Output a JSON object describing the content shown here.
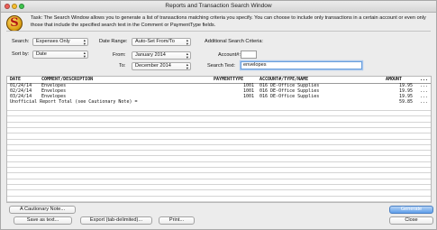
{
  "window": {
    "title": "Reports and Transaction Search Window"
  },
  "logo": {
    "glyph": "S"
  },
  "task_text": "Task: The Search Window allows you to generate a list of transactions matching criteria you specify. You can choose to include only transactions in a certain account or even only those that include the specified search text in the Comment or PaymentType fields.",
  "form": {
    "search_label": "Search:",
    "search_value": "Expenses Only",
    "sortby_label": "Sort by:",
    "sortby_value": "Date",
    "daterange_label": "Date Range:",
    "daterange_value": "Auto-Set From/To",
    "from_label": "From:",
    "from_value": "January 2014",
    "to_label": "To:",
    "to_value": "December 2014",
    "additional_label": "Additional Search Criteria:",
    "account_label": "Account#:",
    "account_value": "",
    "searchtext_label": "Search Text:",
    "searchtext_value": "envelopes"
  },
  "table": {
    "columns": [
      "DATE",
      "COMMENT/DESCRIPTION",
      "PAYMENTTYPE",
      "ACCOUNT#/TYPE/NAME",
      "AMOUNT",
      "..."
    ],
    "rows": [
      [
        "01/24/14",
        "Envelopes",
        "1001",
        "016  DE-Office Supplies",
        "19.95",
        "..."
      ],
      [
        "02/24/14",
        "Envelopes",
        "1001",
        "016  DE-Office Supplies",
        "19.95",
        "..."
      ],
      [
        "03/24/14",
        "Envelopes",
        "1001",
        "016  DE-Office Supplies",
        "19.95",
        "..."
      ]
    ],
    "total_label": "Unofficial Report Total (see Cautionary Note) =",
    "total_value": "59.85",
    "total_dots": "..."
  },
  "buttons": {
    "cautionary": "A Cautionary Note...",
    "generate": "Generate",
    "save_text": "Save as text...",
    "export": "Export (tab-delimited)...",
    "print": "Print...",
    "close": "Close"
  },
  "colors": {
    "accent": "#5f9ee9",
    "focus_ring": "#a9c8ef"
  },
  "icons": {
    "popup": "updown-arrows-icon"
  }
}
